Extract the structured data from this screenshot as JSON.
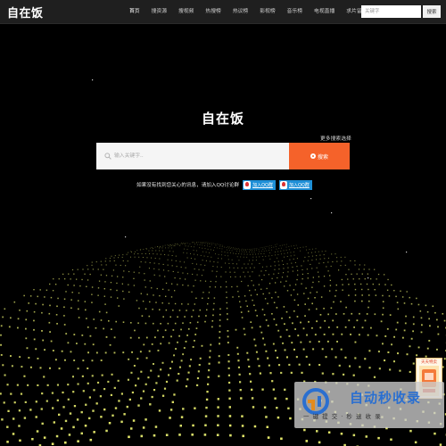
{
  "header": {
    "logo": "自在饭",
    "nav": [
      "首页",
      "搜资源",
      "搜视频",
      "热搜榜",
      "热议榜",
      "影视榜",
      "音乐榜",
      "电视直播",
      "求片留言"
    ],
    "search_placeholder": "关键字",
    "search_button": "搜索"
  },
  "hero": {
    "title": "自在饭",
    "more_options": "更多搜索选择",
    "search_placeholder": "输入关键字..",
    "search_button": "搜索"
  },
  "info": {
    "text": "如果没有找到您关心的讯息，请加入QQ讨论群",
    "qq_buttons": [
      "加入QQ群",
      "加入QQ群"
    ]
  },
  "side_ad": {
    "label": "天天特卖"
  },
  "watermark": {
    "title": "自动秒收录",
    "subtitle": "一 键 提 交 · 秒 速 收 录"
  },
  "colors": {
    "background": "#000000",
    "topbar": "#1f1f1f",
    "accent": "#f5622a",
    "qq_blue": "#1e8fd7",
    "particles": "#e4e86a"
  },
  "icons": [
    "search-icon",
    "qq-icon",
    "dot-icon"
  ]
}
